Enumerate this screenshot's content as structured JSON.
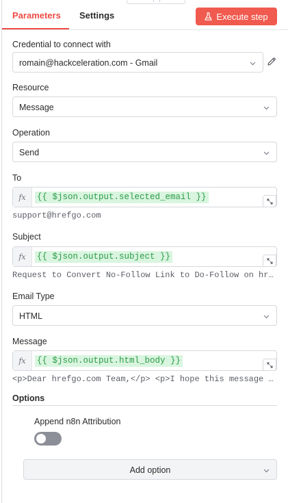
{
  "tabs": {
    "parameters": "Parameters",
    "settings": "Settings",
    "execute": "Execute step"
  },
  "credential": {
    "label": "Credential to connect with",
    "value": "romain@hackceleration.com - Gmail"
  },
  "resource": {
    "label": "Resource",
    "value": "Message"
  },
  "operation": {
    "label": "Operation",
    "value": "Send"
  },
  "to": {
    "label": "To",
    "expression": "{{ $json.output.selected_email }}",
    "preview": "support@hrefgo.com"
  },
  "subject": {
    "label": "Subject",
    "expression": "{{ $json.output.subject }}",
    "preview": "Request to Convert No-Follow Link to Do-Follow on hrefgo.com"
  },
  "email_type": {
    "label": "Email Type",
    "value": "HTML"
  },
  "message": {
    "label": "Message",
    "expression": "{{ $json.output.html_body }}",
    "preview": "<p>Dear hrefgo.com Team,</p> <p>I hope this message finds you well.</p>"
  },
  "options": {
    "title": "Options",
    "append_label": "Append n8n Attribution",
    "append_enabled": false,
    "add_option": "Add option"
  },
  "icons": {
    "execute": "flask-icon",
    "dropdown": "chevron-down-icon",
    "edit": "pencil-icon",
    "expand": "expand-icon",
    "fx": "fx"
  },
  "colors": {
    "accent": "#ee4b44",
    "execute_bg": "#f05a4f",
    "expression_bg": "#d9f5df",
    "expression_text": "#2c9b48"
  }
}
